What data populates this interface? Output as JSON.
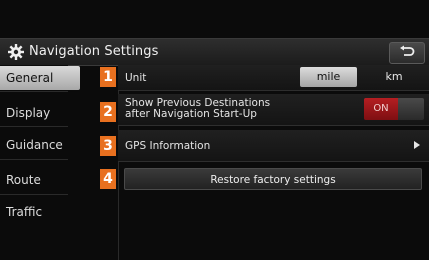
{
  "header": {
    "title": "Navigation Settings",
    "icon": "gear-icon",
    "back_icon": "back-return-icon"
  },
  "sidebar": {
    "items": [
      {
        "label": "General",
        "active": true
      },
      {
        "label": "Display",
        "active": false
      },
      {
        "label": "Guidance",
        "active": false
      },
      {
        "label": "Route",
        "active": false
      },
      {
        "label": "Traffic",
        "active": false
      }
    ]
  },
  "settings": {
    "badges": [
      "1",
      "2",
      "3",
      "4"
    ],
    "unit": {
      "label": "Unit",
      "options": [
        "mile",
        "km"
      ],
      "selected": "mile"
    },
    "show_previous": {
      "label_line1": "Show Previous Destinations",
      "label_line2": "after Navigation Start-Up",
      "toggle_label": "ON"
    },
    "gps": {
      "label": "GPS Information"
    },
    "restore": {
      "label": "Restore factory settings"
    }
  },
  "colors": {
    "badge": "#e8701f",
    "toggle_on": "#b51e22",
    "selected_bg": "#cfcfcf"
  }
}
